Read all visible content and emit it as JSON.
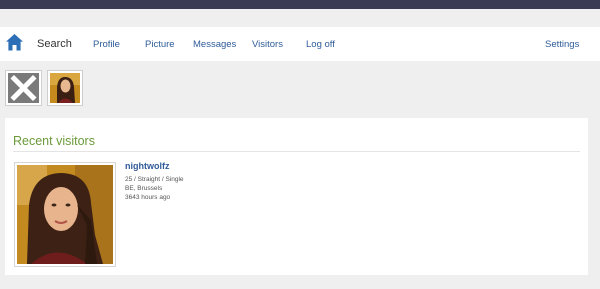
{
  "nav": {
    "search": "Search",
    "links": {
      "profile": "Profile",
      "picture": "Picture",
      "messages": "Messages",
      "visitors": "Visitors",
      "logoff": "Log off",
      "settings": "Settings"
    }
  },
  "icons": {
    "home": "home-icon",
    "close": "close-icon"
  },
  "colors": {
    "topbar": "#3b3a55",
    "link": "#2f5c99",
    "section_title": "#6b9a3a"
  },
  "recent_visitors": {
    "title": "Recent visitors",
    "visitors": [
      {
        "name": "nightwolfz",
        "details": "25 / Straight / Single",
        "location": "BE, Brussels",
        "last_seen": "3643 hours ago"
      }
    ]
  }
}
